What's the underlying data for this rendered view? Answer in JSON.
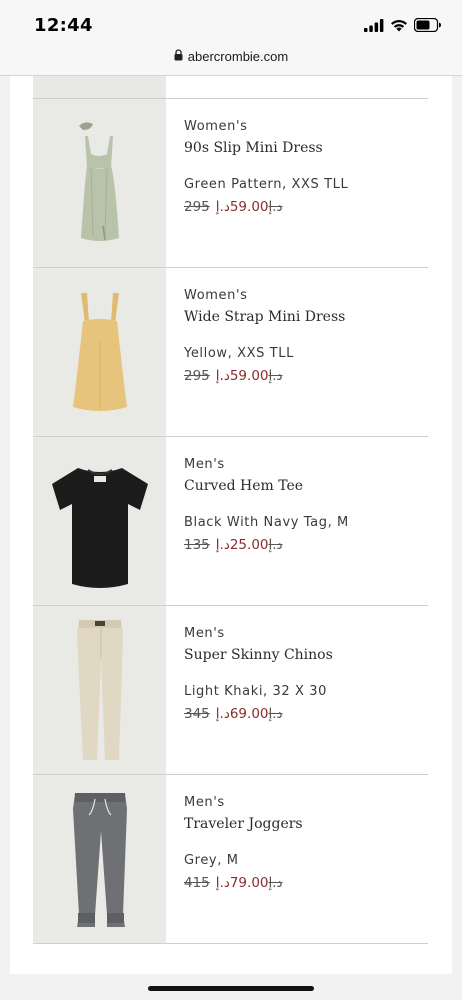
{
  "status_bar": {
    "time": "12:44"
  },
  "url_bar": {
    "url": "abercrombie.com"
  },
  "products": [
    {
      "category": "Women's",
      "title": "90s Slip Mini Dress",
      "variant": "Green Pattern, XXS TLL",
      "original_price": "295د.إ",
      "sale_price": "59.00د.إ",
      "image": "green-slip-dress",
      "color": "#b9c3aa"
    },
    {
      "category": "Women's",
      "title": "Wide Strap Mini Dress",
      "variant": "Yellow, XXS TLL",
      "original_price": "295د.إ",
      "sale_price": "59.00د.إ",
      "image": "yellow-mini-dress",
      "color": "#e6c47b"
    },
    {
      "category": "Men's",
      "title": "Curved Hem Tee",
      "variant": "Black With Navy Tag, M",
      "original_price": "135د.إ",
      "sale_price": "25.00د.إ",
      "image": "black-tee",
      "color": "#1c1c1c"
    },
    {
      "category": "Men's",
      "title": "Super Skinny Chinos",
      "variant": "Light Khaki, 32 X 30",
      "original_price": "345د.إ",
      "sale_price": "69.00د.إ",
      "image": "khaki-chinos",
      "color": "#e0d8c2"
    },
    {
      "category": "Men's",
      "title": "Traveler Joggers",
      "variant": "Grey, M",
      "original_price": "415د.إ",
      "sale_price": "79.00د.إ",
      "image": "grey-joggers",
      "color": "#6f7073"
    }
  ]
}
